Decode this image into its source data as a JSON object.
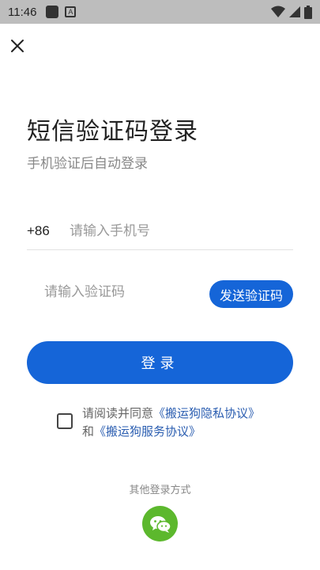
{
  "status_bar": {
    "time": "11:46"
  },
  "page": {
    "title": "短信验证码登录",
    "subtitle": "手机验证后自动登录"
  },
  "phone": {
    "prefix": "+86",
    "placeholder": "请输入手机号",
    "value": ""
  },
  "code": {
    "placeholder": "请输入验证码",
    "value": "",
    "send_label": "发送验证码"
  },
  "login": {
    "label": "登录"
  },
  "agreement": {
    "prefix": "请阅读并同意",
    "privacy_link": "《搬运狗隐私协议》",
    "and": "和",
    "service_link": "《搬运狗服务协议》",
    "checked": false
  },
  "other_login": {
    "label": "其他登录方式"
  },
  "colors": {
    "primary": "#1565d8",
    "wechat": "#5cb82d",
    "link": "#2a5db0"
  },
  "icons": [
    "close-icon",
    "wechat-icon",
    "wifi-icon",
    "signal-icon",
    "battery-icon"
  ]
}
